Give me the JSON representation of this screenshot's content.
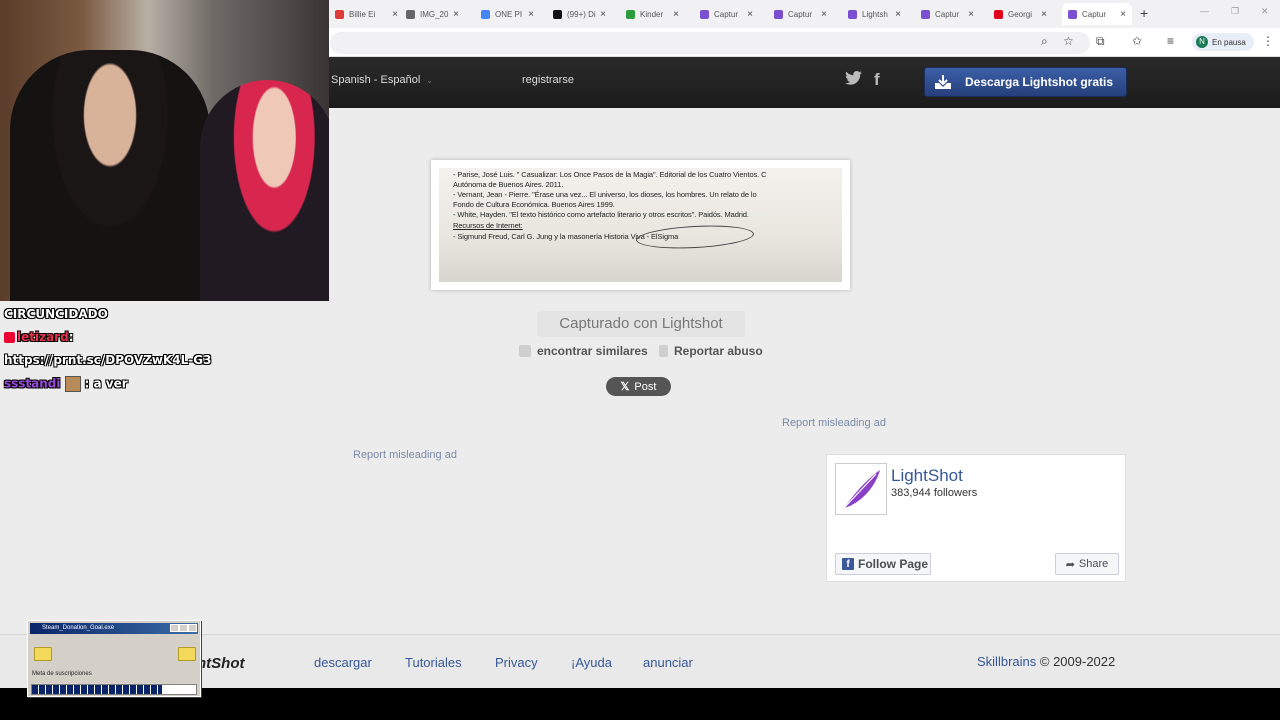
{
  "browser": {
    "tabs": [
      {
        "label": "Billie Ei",
        "favicon_color": "#e03b3b"
      },
      {
        "label": "IMG_20",
        "favicon_color": "#666666"
      },
      {
        "label": "ONE PI",
        "favicon_color": "#4285f4"
      },
      {
        "label": "(99+) Di",
        "favicon_color": "#111111"
      },
      {
        "label": "Kinder",
        "favicon_color": "#2a9d3a"
      },
      {
        "label": "Captur",
        "favicon_color": "#7b4fd1"
      },
      {
        "label": "Captur",
        "favicon_color": "#7b4fd1"
      },
      {
        "label": "Lightsh",
        "favicon_color": "#7b4fd1"
      },
      {
        "label": "Captur",
        "favicon_color": "#7b4fd1"
      },
      {
        "label": "Georgi",
        "favicon_color": "#e3001b"
      },
      {
        "label": "Captur",
        "favicon_color": "#7b4fd1",
        "active": true
      }
    ],
    "new_tab": "+",
    "profile_initial": "N",
    "profile_status": "En pausa"
  },
  "header": {
    "language": "Spanish - Español",
    "register": "registrarse",
    "download_button": "Descarga Lightshot gratis",
    "social": [
      "twitter-icon",
      "facebook-icon"
    ]
  },
  "screenshot_text": [
    "- Parise, José Luis. \" Casualizar: Los Once Pasos de la Magia\". Editorial de los Cuatro Vientos. C",
    "  Autónoma de Buenos Aires. 2011.",
    "- Vernant, Jean - Pierre. \"Érase una vez... El universo, los dioses, los hombres. Un relato de lo",
    "  Fondo de Cultura Económica. Buenos Aires 1999.",
    "- White, Hayden. \"El texto histórico como artefacto literario y otros escritos\". Paidós. Madrid.",
    "  Recursos de Internet:",
    "- Sigmund Freud, Carl G. Jung y la masonería  Historia Viva - ElSigma"
  ],
  "main": {
    "caption": "Capturado con Lightshot",
    "find_similar": "encontrar similares",
    "report_abuse": "Reportar abuso",
    "post_button": "Post",
    "report_ad_right": "Report misleading ad",
    "report_ad_left": "Report misleading ad"
  },
  "facebook": {
    "page_name": "LightShot",
    "followers": "383,944 followers",
    "follow_button": "Follow Page",
    "share_button": "Share"
  },
  "footer": {
    "logo": "htShot",
    "links": [
      "descargar",
      "Tutoriales",
      "Privacy",
      "¡Ayuda",
      "anunciar"
    ],
    "company": "Skillbrains",
    "copyright": "© 2009-2022"
  },
  "stream": {
    "chat": [
      {
        "user": "",
        "text": "CIRCUNCIDADO"
      },
      {
        "user": "letizard",
        "text": ":"
      },
      {
        "user": "",
        "text": "https://prnt.sc/DPOVZwK4L-G3"
      },
      {
        "user": "ssstandi",
        "text": ": a ver"
      }
    ],
    "goal_window_title": "Steam_Donation_Goal.exe",
    "goal_label": "Meta de suscripciones",
    "goal_progress": 0.79
  }
}
